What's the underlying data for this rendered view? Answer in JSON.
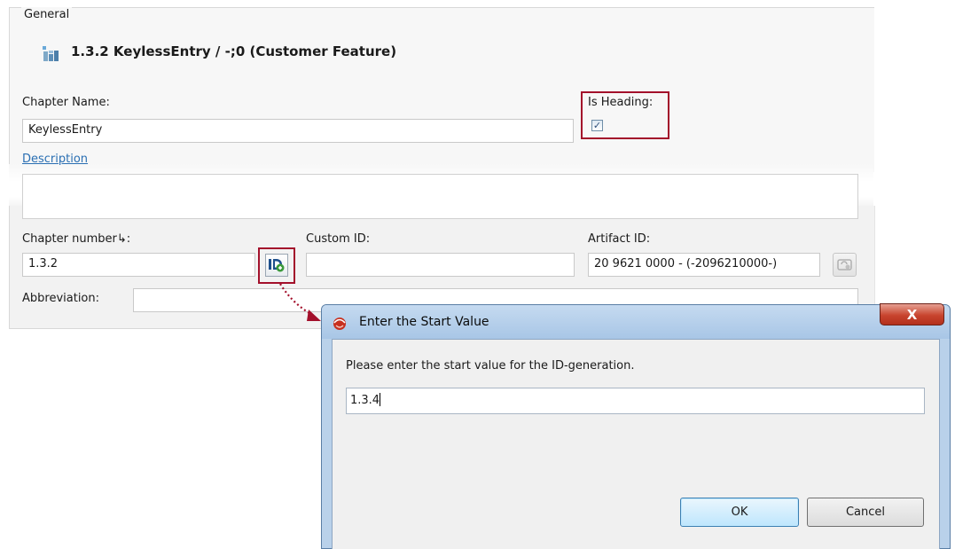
{
  "group": {
    "label": "General"
  },
  "header": {
    "title": "1.3.2 KeylessEntry / -;0 (Customer Feature)",
    "icon": "feature-grid-icon"
  },
  "form": {
    "chapter_name_label": "Chapter Name:",
    "chapter_name_value": "KeylessEntry",
    "is_heading_label": "Is Heading:",
    "is_heading_checked": true,
    "description_link": "Description",
    "chapter_number_label": "Chapter number↳:",
    "chapter_number_value": "1.3.2",
    "custom_id_label": "Custom ID:",
    "custom_id_value": "",
    "artifact_id_label": "Artifact ID:",
    "artifact_id_value": "20 9621 0000 - (-2096210000-)",
    "abbreviation_label": "Abbreviation:",
    "abbreviation_value": ""
  },
  "icons": {
    "id_generate": "id-generate-icon",
    "artifact_action": "refresh-id-icon",
    "dialog": "app-logo-icon",
    "close": "close-icon"
  },
  "highlight_color": "#a3102b",
  "dialog": {
    "title": "Enter the Start Value",
    "prompt": "Please enter the start value for the ID-generation.",
    "input_value": "1.3.4",
    "ok_label": "OK",
    "cancel_label": "Cancel",
    "close_symbol": "X"
  }
}
